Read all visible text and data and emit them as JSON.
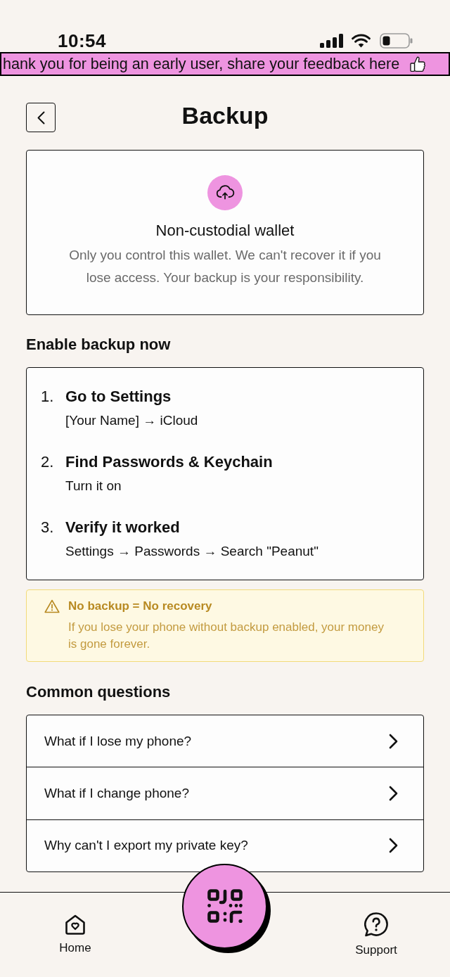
{
  "status_bar": {
    "time": "10:54"
  },
  "banner": {
    "text": "hank you for being an early user, share your feedback here"
  },
  "header": {
    "title": "Backup"
  },
  "info_card": {
    "title": "Non-custodial wallet",
    "description": "Only you control this wallet. We can't recover it if you lose access. Your backup is your responsibility."
  },
  "steps_section": {
    "heading": "Enable backup now",
    "steps": [
      {
        "number": "1.",
        "title": "Go to Settings",
        "detail": "[Your Name] → iCloud"
      },
      {
        "number": "2.",
        "title": "Find Passwords & Keychain",
        "detail": "Turn it on"
      },
      {
        "number": "3.",
        "title": "Verify it worked",
        "detail": "Settings → Passwords → Search \"Peanut\""
      }
    ]
  },
  "warning": {
    "title": "No backup = No recovery",
    "message": "If you lose your phone without backup enabled, your money is gone forever."
  },
  "faq_section": {
    "heading": "Common questions",
    "items": [
      {
        "question": "What if I lose my phone?"
      },
      {
        "question": "What if I change phone?"
      },
      {
        "question": "Why can't I export my private key?"
      }
    ]
  },
  "bottom_nav": {
    "items": [
      {
        "kind": "home",
        "label": "Home"
      },
      {
        "kind": "support",
        "label": "Support"
      }
    ]
  }
}
